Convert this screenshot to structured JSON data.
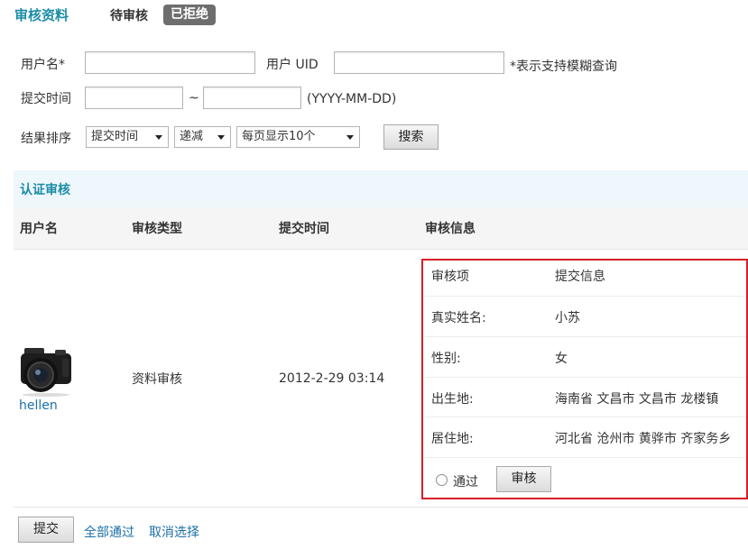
{
  "tabs": {
    "title": "审核资料",
    "pending": "待审核",
    "rejected": "已拒绝"
  },
  "filters": {
    "username_label": "用户名*",
    "uid_label": "用户 UID",
    "fuzzy_hint": "*表示支持模糊查询",
    "submit_time_label": "提交时间",
    "range_sep": "~",
    "date_format_hint": "(YYYY-MM-DD)",
    "sort_label": "结果排序",
    "sort_field": "提交时间",
    "sort_order": "递减",
    "per_page": "每页显示10个",
    "search_button": "搜索"
  },
  "section": {
    "title": "认证审核"
  },
  "table": {
    "headers": [
      "用户名",
      "审核类型",
      "提交时间",
      "审核信息"
    ],
    "row": {
      "username": "hellen",
      "type": "资料审核",
      "time": "2012-2-29 03:14",
      "info": [
        {
          "key": "审核项",
          "value": "提交信息"
        },
        {
          "key": "真实姓名:",
          "value": "小苏"
        },
        {
          "key": "性别:",
          "value": "女"
        },
        {
          "key": "出生地:",
          "value": "海南省  文昌市  文昌市  龙楼镇"
        },
        {
          "key": "居住地:",
          "value": "河北省  沧州市  黄骅市  齐家务乡"
        }
      ],
      "pass_label": "通过",
      "review_button": "审核"
    }
  },
  "footer": {
    "submit_button": "提交",
    "pass_all": "全部通过",
    "cancel_selection": "取消选择"
  },
  "colors": {
    "accent": "#1b8ca6",
    "link": "#1b6fa6",
    "highlight_border": "#d61f26",
    "tab_active_bg": "#6e6e6e"
  }
}
